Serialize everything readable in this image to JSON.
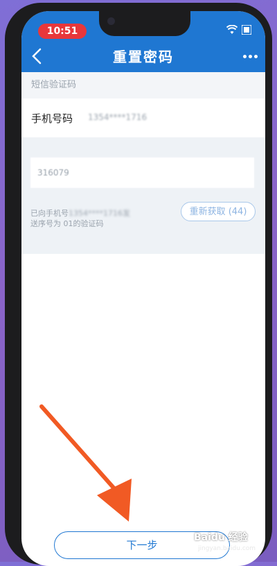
{
  "status_bar": {
    "time": "10:51"
  },
  "header": {
    "title": "重置密码"
  },
  "form": {
    "section_label": "短信验证码",
    "phone_label": "手机号码",
    "phone_value": "1354****1716",
    "code_value": "316079",
    "sms_note_prefix": "已向手机号",
    "sms_note_masked": "1354****1716发",
    "sms_note_line2": "送序号为 01的验证码",
    "resend_label": "重新获取 (44)",
    "next_label": "下一步"
  },
  "watermark": {
    "text": "Baidu 经验",
    "sub": "jingyan.baidu.com"
  },
  "colors": {
    "brand_blue": "#1f77d2",
    "arrow": "#f15a24"
  }
}
